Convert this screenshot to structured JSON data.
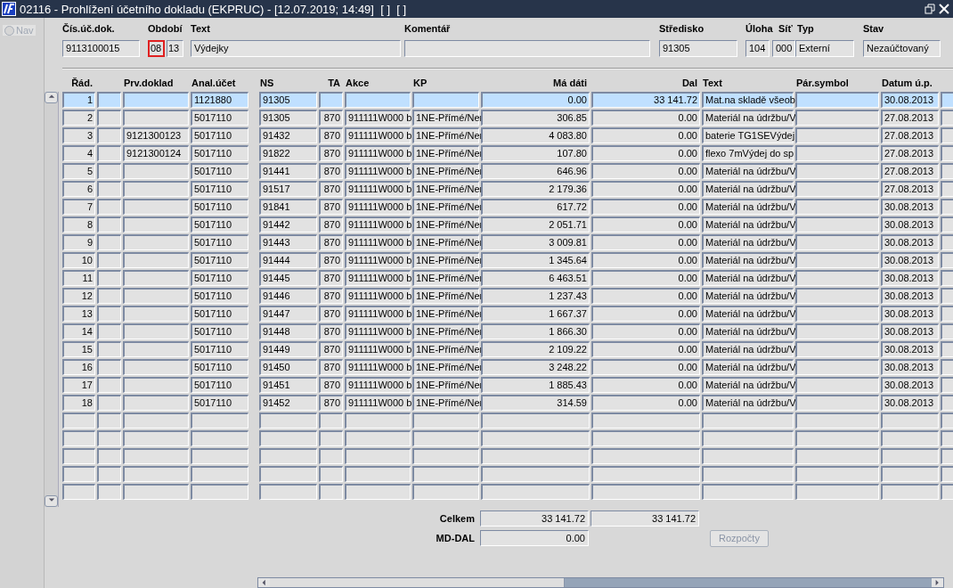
{
  "window": {
    "title": "02116 - Prohlížení účetního dokladu (EKPRUC) - [12.07.2019; 14:49]  [ ]  [ ]"
  },
  "nav": {
    "label": "Nav",
    "checked": false,
    "disabled": true
  },
  "header_fields": [
    {
      "label": "Čís.úč.dok.",
      "boxes": [
        {
          "value": "9113100015",
          "focused": false
        }
      ]
    },
    {
      "label": "Období",
      "boxes": [
        {
          "value": "08",
          "focused": true
        },
        {
          "value": "13",
          "focused": false
        }
      ]
    },
    {
      "label": "Text",
      "boxes": [
        {
          "value": "Výdejky",
          "focused": false
        }
      ]
    },
    {
      "label": "Komentář",
      "boxes": [
        {
          "focused": false
        }
      ]
    },
    {
      "label": "Středisko",
      "boxes": [
        {
          "value": "91305",
          "focused": false
        }
      ]
    },
    {
      "label": "Úloha",
      "boxes": [
        {
          "value": "104",
          "focused": false
        }
      ]
    },
    {
      "label": "Síť",
      "boxes": [
        {
          "value": "000",
          "focused": false
        }
      ]
    },
    {
      "label": "Typ",
      "boxes": [
        {
          "value": "Externí",
          "focused": false
        }
      ]
    },
    {
      "label": "Stav",
      "boxes": [
        {
          "value": "Nezaúčtovaný",
          "focused": false
        }
      ]
    }
  ],
  "table": {
    "columns": [
      {
        "label": "Řád.",
        "kind": "numeric"
      },
      {
        "kind": "text"
      },
      {
        "label": "Prv.doklad",
        "kind": "text"
      },
      {
        "label": "Anal.účet",
        "kind": "text"
      },
      {
        "label": "NS",
        "kind": "text"
      },
      {
        "label": "TA",
        "kind": "numeric"
      },
      {
        "label": "Akce",
        "kind": "text"
      },
      {
        "label": "KP",
        "kind": "text"
      },
      {
        "label": "Má dáti",
        "kind": "numeric"
      },
      {
        "label": "Dal",
        "kind": "numeric"
      },
      {
        "label": "Text",
        "kind": "text"
      },
      {
        "label": "Pár.symbol",
        "kind": "text"
      },
      {
        "label": "Datum ú.p.",
        "kind": "text"
      },
      {
        "kind": "text"
      }
    ],
    "rows": [
      {
        "selected": true,
        "cells": [
          "1",
          null,
          null,
          "1121880",
          "91305",
          null,
          null,
          null,
          "0.00",
          "33 141.72",
          "Mat.na skladě všeob",
          null,
          "30.08.2013",
          null
        ]
      },
      {
        "selected": false,
        "cells": [
          "2",
          null,
          null,
          "5017110",
          "91305",
          "870",
          "911111W000 b",
          "1NE-Přímé/Ner",
          "306.85",
          "0.00",
          "Materiál na údržbu/V",
          null,
          "27.08.2013",
          null
        ]
      },
      {
        "selected": false,
        "cells": [
          "3",
          null,
          "9121300123",
          "5017110",
          "91432",
          "870",
          "911111W000 b",
          "1NE-Přímé/Ner",
          "4 083.80",
          "0.00",
          "baterie TG1SEVýdej",
          null,
          "27.08.2013",
          null
        ]
      },
      {
        "selected": false,
        "cells": [
          "4",
          null,
          "9121300124",
          "5017110",
          "91822",
          "870",
          "911111W000 b",
          "1NE-Přímé/Ner",
          "107.80",
          "0.00",
          "flexo 7mVýdej do sp",
          null,
          "27.08.2013",
          null
        ]
      },
      {
        "selected": false,
        "cells": [
          "5",
          null,
          null,
          "5017110",
          "91441",
          "870",
          "911111W000 b",
          "1NE-Přímé/Ner",
          "646.96",
          "0.00",
          "Materiál na údržbu/V",
          null,
          "27.08.2013",
          null
        ]
      },
      {
        "selected": false,
        "cells": [
          "6",
          null,
          null,
          "5017110",
          "91517",
          "870",
          "911111W000 b",
          "1NE-Přímé/Ner",
          "2 179.36",
          "0.00",
          "Materiál na údržbu/V",
          null,
          "27.08.2013",
          null
        ]
      },
      {
        "selected": false,
        "cells": [
          "7",
          null,
          null,
          "5017110",
          "91841",
          "870",
          "911111W000 b",
          "1NE-Přímé/Ner",
          "617.72",
          "0.00",
          "Materiál na údržbu/V",
          null,
          "30.08.2013",
          null
        ]
      },
      {
        "selected": false,
        "cells": [
          "8",
          null,
          null,
          "5017110",
          "91442",
          "870",
          "911111W000 b",
          "1NE-Přímé/Ner",
          "2 051.71",
          "0.00",
          "Materiál na údržbu/V",
          null,
          "30.08.2013",
          null
        ]
      },
      {
        "selected": false,
        "cells": [
          "9",
          null,
          null,
          "5017110",
          "91443",
          "870",
          "911111W000 b",
          "1NE-Přímé/Ner",
          "3 009.81",
          "0.00",
          "Materiál na údržbu/V",
          null,
          "30.08.2013",
          null
        ]
      },
      {
        "selected": false,
        "cells": [
          "10",
          null,
          null,
          "5017110",
          "91444",
          "870",
          "911111W000 b",
          "1NE-Přímé/Ner",
          "1 345.64",
          "0.00",
          "Materiál na údržbu/V",
          null,
          "30.08.2013",
          null
        ]
      },
      {
        "selected": false,
        "cells": [
          "11",
          null,
          null,
          "5017110",
          "91445",
          "870",
          "911111W000 b",
          "1NE-Přímé/Ner",
          "6 463.51",
          "0.00",
          "Materiál na údržbu/V",
          null,
          "30.08.2013",
          null
        ]
      },
      {
        "selected": false,
        "cells": [
          "12",
          null,
          null,
          "5017110",
          "91446",
          "870",
          "911111W000 b",
          "1NE-Přímé/Ner",
          "1 237.43",
          "0.00",
          "Materiál na údržbu/V",
          null,
          "30.08.2013",
          null
        ]
      },
      {
        "selected": false,
        "cells": [
          "13",
          null,
          null,
          "5017110",
          "91447",
          "870",
          "911111W000 b",
          "1NE-Přímé/Ner",
          "1 667.37",
          "0.00",
          "Materiál na údržbu/V",
          null,
          "30.08.2013",
          null
        ]
      },
      {
        "selected": false,
        "cells": [
          "14",
          null,
          null,
          "5017110",
          "91448",
          "870",
          "911111W000 b",
          "1NE-Přímé/Ner",
          "1 866.30",
          "0.00",
          "Materiál na údržbu/V",
          null,
          "30.08.2013",
          null
        ]
      },
      {
        "selected": false,
        "cells": [
          "15",
          null,
          null,
          "5017110",
          "91449",
          "870",
          "911111W000 b",
          "1NE-Přímé/Ner",
          "2 109.22",
          "0.00",
          "Materiál na údržbu/V",
          null,
          "30.08.2013",
          null
        ]
      },
      {
        "selected": false,
        "cells": [
          "16",
          null,
          null,
          "5017110",
          "91450",
          "870",
          "911111W000 b",
          "1NE-Přímé/Ner",
          "3 248.22",
          "0.00",
          "Materiál na údržbu/V",
          null,
          "30.08.2013",
          null
        ]
      },
      {
        "selected": false,
        "cells": [
          "17",
          null,
          null,
          "5017110",
          "91451",
          "870",
          "911111W000 b",
          "1NE-Přímé/Ner",
          "1 885.43",
          "0.00",
          "Materiál na údržbu/V",
          null,
          "30.08.2013",
          null
        ]
      },
      {
        "selected": false,
        "cells": [
          "18",
          null,
          null,
          "5017110",
          "91452",
          "870",
          "911111W000 b",
          "1NE-Přímé/Ner",
          "314.59",
          "0.00",
          "Materiál na údržbu/V",
          null,
          "30.08.2013",
          null
        ]
      }
    ]
  },
  "totals": {
    "label": "Celkem",
    "values": [
      "33 141.72",
      "33 141.72"
    ]
  },
  "difference": {
    "label": "MD-DAL",
    "value": "0.00"
  },
  "budget_button": {
    "label": "Rozpočty",
    "disabled": true
  }
}
